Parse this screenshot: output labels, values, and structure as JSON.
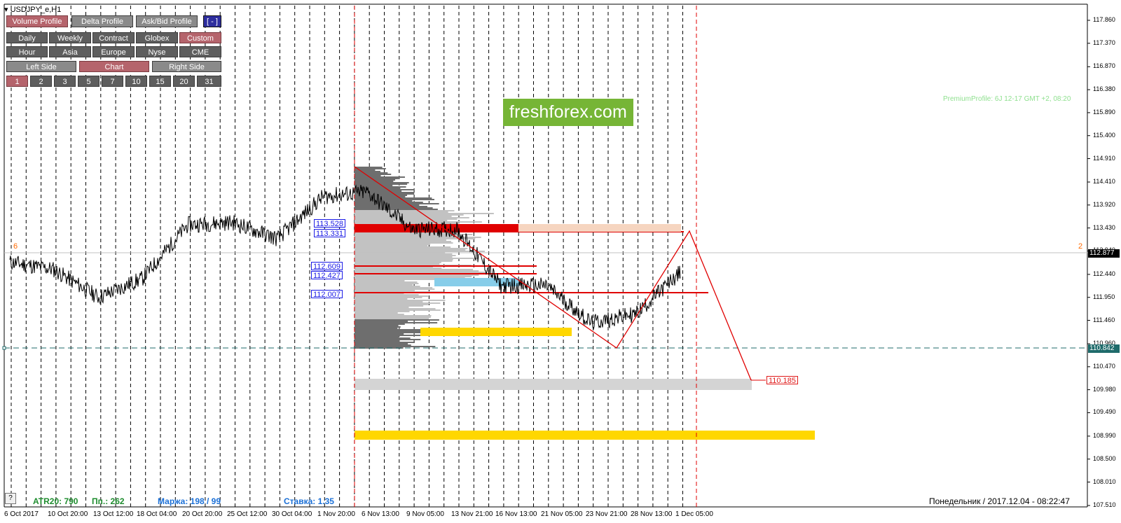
{
  "window": {
    "symbol": "USDJPY_e,H1"
  },
  "toolbar": {
    "row1": [
      "Volume Profile",
      "Delta Profile",
      "Ask/Bid Profile",
      "[ - ]"
    ],
    "row2": [
      "Daily",
      "Weekly",
      "Contract",
      "Globex",
      "Custom"
    ],
    "row3": [
      "Hour",
      "Asia",
      "Europe",
      "Nyse",
      "CME"
    ],
    "row4": [
      "Left Side",
      "Chart",
      "Right Side"
    ],
    "row5": [
      "1",
      "2",
      "3",
      "5",
      "7",
      "10",
      "15",
      "20",
      "31"
    ]
  },
  "logo": {
    "text": "freshforex.com"
  },
  "premium_profile": "PremiumProfile:  6J 12-17 GMT +2, 08:20",
  "level_labels": [
    "113.528",
    "113.331",
    "112.609",
    "112.427",
    "112.007"
  ],
  "target_label": "110.185",
  "markers": {
    "left": "6",
    "right": "2"
  },
  "status": {
    "atr": "ATR20: 790",
    "pip": "Пп.: 262",
    "margin": "Маржа: 198 / 99",
    "rate": "Ставка: 1.35"
  },
  "help_button": "?",
  "clock": "Понедельник  /  2017.12.04  -  08:22:47",
  "price_axis": [
    "117.860",
    "117.370",
    "116.870",
    "116.380",
    "115.890",
    "115.400",
    "114.910",
    "114.410",
    "113.920",
    "113.430",
    "112.940",
    "112.440",
    "111.950",
    "111.460",
    "110.960",
    "110.470",
    "109.980",
    "109.490",
    "108.990",
    "108.500",
    "108.010",
    "107.510"
  ],
  "price_tags": {
    "current": "112.877",
    "stop": "110.842"
  },
  "colors": {
    "current_tag": "#000000",
    "stop_tag": "#1f6b6b",
    "volume_dark": "#6e6e6e",
    "volume_light": "#c2c2c2",
    "poc_red": "#e00000",
    "value_area_blue": "#87cde9",
    "zone_yellow": "#ffd700"
  },
  "time_axis": [
    "6 Oct 2017",
    "10 Oct 20:00",
    "13 Oct 12:00",
    "18 Oct 04:00",
    "20 Oct 20:00",
    "25 Oct 12:00",
    "30 Oct 04:00",
    "1 Nov 20:00",
    "6 Nov 13:00",
    "9 Nov 05:00",
    "13 Nov 21:00",
    "16 Nov 13:00",
    "21 Nov 05:00",
    "23 Nov 21:00",
    "28 Nov 13:00",
    "1 Dec 05:00"
  ],
  "chart_data": {
    "type": "line",
    "symbol": "USDJPY",
    "timeframe": "H1",
    "ylim": [
      107.51,
      117.86
    ],
    "anchors": [
      {
        "t": "6 Oct 2017",
        "price": 112.7
      },
      {
        "t": "10 Oct 20:00",
        "price": 112.55
      },
      {
        "t": "13 Oct 12:00",
        "price": 111.95
      },
      {
        "t": "18 Oct 04:00",
        "price": 112.35
      },
      {
        "t": "20 Oct 20:00",
        "price": 113.5
      },
      {
        "t": "25 Oct 12:00",
        "price": 113.55
      },
      {
        "t": "30 Oct 04:00",
        "price": 113.2
      },
      {
        "t": "1 Nov 20:00",
        "price": 114.1
      },
      {
        "t": "6 Nov 13:00",
        "price": 114.2
      },
      {
        "t": "9 Nov 05:00",
        "price": 113.4
      },
      {
        "t": "13 Nov 21:00",
        "price": 113.4
      },
      {
        "t": "16 Nov 13:00",
        "price": 112.2
      },
      {
        "t": "21 Nov 05:00",
        "price": 112.2
      },
      {
        "t": "23 Nov 21:00",
        "price": 111.4
      },
      {
        "t": "28 Nov 13:00",
        "price": 111.6
      },
      {
        "t": "1 Dec 05:00",
        "price": 112.5
      }
    ]
  }
}
